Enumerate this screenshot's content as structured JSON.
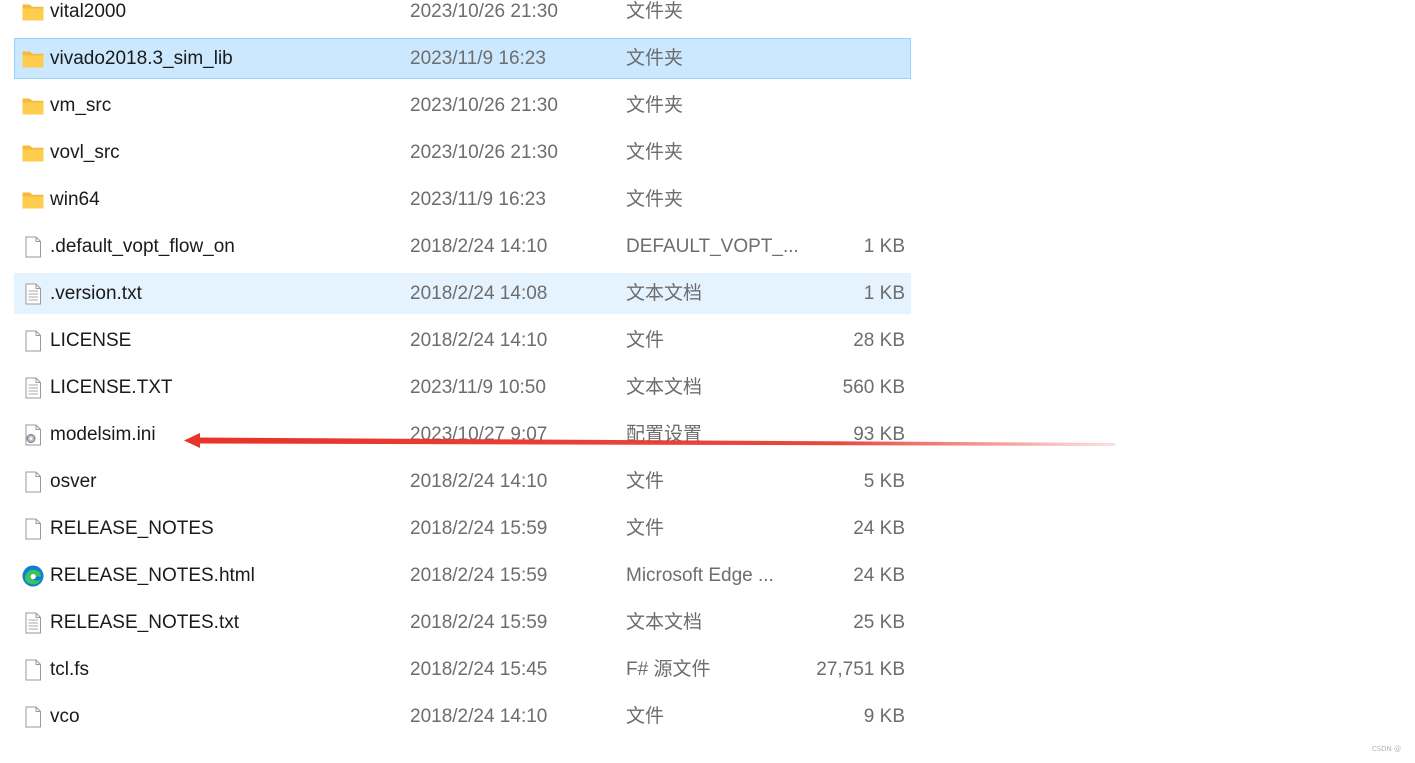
{
  "colors": {
    "folder": "#ffcc4d",
    "selection_bg": "#cce8ff",
    "selection_border": "#99d1ff",
    "hover_bg": "#e5f3ff",
    "secondary_text": "#6d6d6d",
    "annotation_arrow": "#e8332a"
  },
  "files": [
    {
      "name": "vital2000",
      "date": "2023/10/26 21:30",
      "type": "文件夹",
      "size": "",
      "icon": "folder-icon",
      "state": ""
    },
    {
      "name": "vivado2018.3_sim_lib",
      "date": "2023/11/9 16:23",
      "type": "文件夹",
      "size": "",
      "icon": "folder-icon",
      "state": "selected"
    },
    {
      "name": "vm_src",
      "date": "2023/10/26 21:30",
      "type": "文件夹",
      "size": "",
      "icon": "folder-icon",
      "state": ""
    },
    {
      "name": "vovl_src",
      "date": "2023/10/26 21:30",
      "type": "文件夹",
      "size": "",
      "icon": "folder-icon",
      "state": ""
    },
    {
      "name": "win64",
      "date": "2023/11/9 16:23",
      "type": "文件夹",
      "size": "",
      "icon": "folder-icon",
      "state": ""
    },
    {
      "name": ".default_vopt_flow_on",
      "date": "2018/2/24 14:10",
      "type": "DEFAULT_VOPT_...",
      "size": "1 KB",
      "icon": "blank-file-icon",
      "state": ""
    },
    {
      "name": ".version.txt",
      "date": "2018/2/24 14:08",
      "type": "文本文档",
      "size": "1 KB",
      "icon": "text-file-icon",
      "state": "hovered"
    },
    {
      "name": "LICENSE",
      "date": "2018/2/24 14:10",
      "type": "文件",
      "size": "28 KB",
      "icon": "blank-file-icon",
      "state": ""
    },
    {
      "name": "LICENSE.TXT",
      "date": "2023/11/9 10:50",
      "type": "文本文档",
      "size": "560 KB",
      "icon": "text-file-icon",
      "state": ""
    },
    {
      "name": "modelsim.ini",
      "date": "2023/10/27 9:07",
      "type": "配置设置",
      "size": "93 KB",
      "icon": "config-file-icon",
      "state": ""
    },
    {
      "name": "osver",
      "date": "2018/2/24 14:10",
      "type": "文件",
      "size": "5 KB",
      "icon": "blank-file-icon",
      "state": ""
    },
    {
      "name": "RELEASE_NOTES",
      "date": "2018/2/24 15:59",
      "type": "文件",
      "size": "24 KB",
      "icon": "blank-file-icon",
      "state": ""
    },
    {
      "name": "RELEASE_NOTES.html",
      "date": "2018/2/24 15:59",
      "type": "Microsoft Edge ...",
      "size": "24 KB",
      "icon": "edge-icon",
      "state": ""
    },
    {
      "name": "RELEASE_NOTES.txt",
      "date": "2018/2/24 15:59",
      "type": "文本文档",
      "size": "25 KB",
      "icon": "text-file-icon",
      "state": ""
    },
    {
      "name": "tcl.fs",
      "date": "2018/2/24 15:45",
      "type": "F# 源文件",
      "size": "27,751 KB",
      "icon": "blank-file-icon",
      "state": ""
    },
    {
      "name": "vco",
      "date": "2018/2/24 14:10",
      "type": "文件",
      "size": "9 KB",
      "icon": "blank-file-icon",
      "state": ""
    }
  ],
  "watermark": "CSDN @"
}
